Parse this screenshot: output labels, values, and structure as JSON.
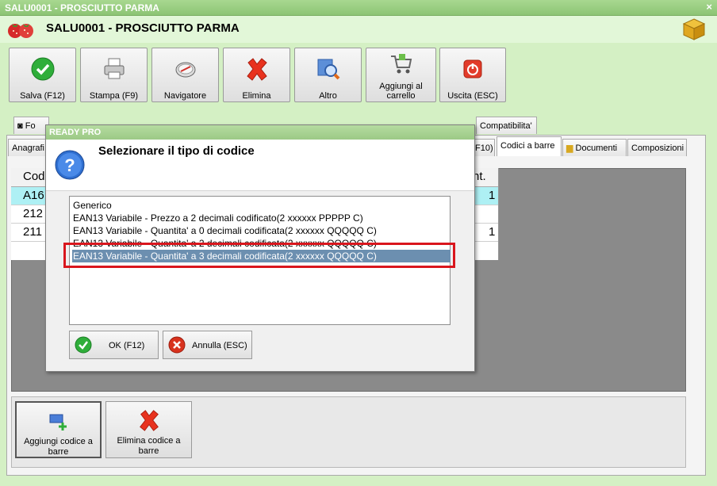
{
  "window": {
    "title": "SALU0001 - PROSCIUTTO PARMA",
    "close": "×"
  },
  "header": {
    "product_name": "SALU0001 - PROSCIUTTO PARMA"
  },
  "toolbar": [
    {
      "label": "Salva (F12)"
    },
    {
      "label": "Stampa (F9)"
    },
    {
      "label": "Navigatore"
    },
    {
      "label": "Elimina"
    },
    {
      "label": "Altro"
    },
    {
      "label": "Aggiungi al carrello"
    },
    {
      "label": "Uscita (ESC)"
    }
  ],
  "tabs_top": {
    "first_partial": "Fo",
    "compat": "Compatibilita'"
  },
  "tabs_bottom": {
    "anagrafica_partial": "Anagrafi",
    "f10_partial": "F10)",
    "codici": "Codici a barre",
    "documenti": "Documenti",
    "composizioni": "Composizioni"
  },
  "grid": {
    "header_code": "Codi",
    "header_qty": "nt.",
    "rows": [
      {
        "code": "A16",
        "qty": "1"
      },
      {
        "code": "212",
        "qty": ""
      },
      {
        "code": "211",
        "qty": "1"
      }
    ]
  },
  "bottom_buttons": [
    {
      "label": "Aggiungi codice a barre"
    },
    {
      "label": "Elimina codice a barre"
    }
  ],
  "dialog": {
    "title": "READY PRO",
    "message": "Selezionare il tipo di codice",
    "options": [
      "Generico",
      "EAN13 Variabile - Prezzo a 2 decimali codificato(2 xxxxxx PPPPP C)",
      "EAN13 Variabile - Quantita' a 0 decimali codificata(2 xxxxxx QQQQQ C)",
      "EAN13 Variabile - Quantita' a 2 decimali codificata(2 xxxxxx QQQQQ C)",
      "EAN13 Variabile - Quantita' a 3 decimali codificata(2 xxxxxx QQQQQ C)"
    ],
    "selected_index": 4,
    "ok_label": "OK (F12)",
    "cancel_label": "Annulla (ESC)"
  },
  "colors": {
    "accent_green": "#a8d890",
    "selection": "#6c8fb0",
    "highlight_red": "#d9161d"
  }
}
